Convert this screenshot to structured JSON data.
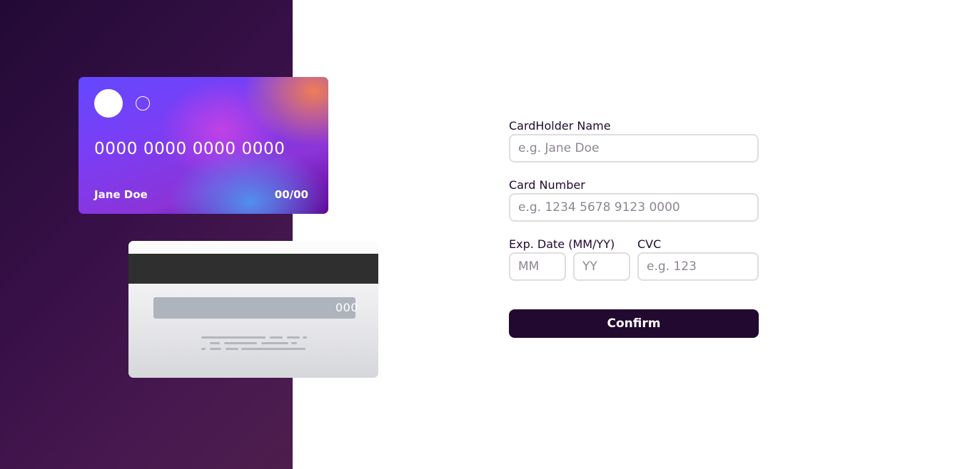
{
  "card_front": {
    "number": "0000 0000 0000 0000",
    "name": "Jane Doe",
    "expiry": "00/00"
  },
  "card_back": {
    "cvc": "000"
  },
  "form": {
    "name_label": "CardHolder Name",
    "name_placeholder": "e.g. Jane Doe",
    "number_label": "Card Number",
    "number_placeholder": "e.g. 1234 5678 9123 0000",
    "exp_label": "Exp. Date (MM/YY)",
    "month_placeholder": "MM",
    "year_placeholder": "YY",
    "cvc_label": "CVC",
    "cvc_placeholder": "e.g. 123",
    "confirm_label": "Confirm"
  },
  "colors": {
    "panel_dark": "#220a35",
    "button": "#21092f",
    "input_border": "#dedddf"
  }
}
